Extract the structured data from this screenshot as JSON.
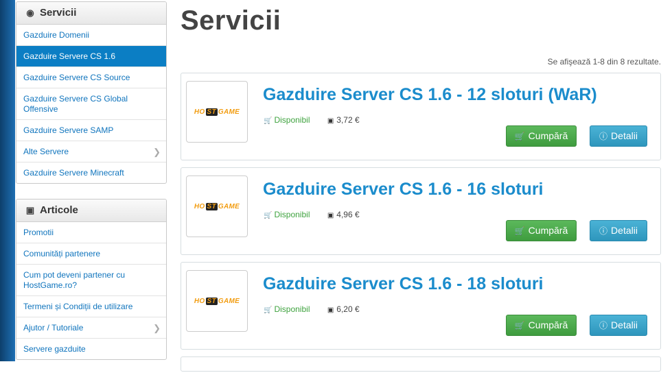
{
  "sidebar": {
    "services": {
      "title": "Servicii",
      "icon": "globe-icon",
      "items": [
        {
          "label": "Gazduire Domenii",
          "active": false
        },
        {
          "label": "Gazduire Servere CS 1.6",
          "active": true
        },
        {
          "label": "Gazduire Servere CS Source",
          "active": false
        },
        {
          "label": "Gazduire Servere CS Global Offensive",
          "active": false
        },
        {
          "label": "Gazduire Servere SAMP",
          "active": false
        },
        {
          "label": "Alte Servere",
          "active": false,
          "has_submenu": true
        },
        {
          "label": "Gazduire Servere Minecraft",
          "active": false
        }
      ]
    },
    "articles": {
      "title": "Articole",
      "icon": "book-icon",
      "items": [
        {
          "label": "Promotii"
        },
        {
          "label": "Comunități partenere"
        },
        {
          "label": "Cum pot deveni partener cu HostGame.ro?"
        },
        {
          "label": "Termeni și Condiții de utilizare"
        },
        {
          "label": "Ajutor / Tutoriale",
          "has_submenu": true
        },
        {
          "label": "Servere gazduite"
        }
      ]
    }
  },
  "main": {
    "title": "Servicii",
    "results_text": "Se afişează 1-8 din 8 rezultate.",
    "products": [
      {
        "title": "Gazduire Server CS 1.6 - 12 sloturi (WaR)",
        "status": "Disponibil",
        "price": "3,72 €",
        "buy_label": "Cumpără",
        "details_label": "Detalii",
        "logo": {
          "left": "HO",
          "mid": "ST",
          "right": "GAME"
        }
      },
      {
        "title": "Gazduire Server CS 1.6 - 16 sloturi",
        "status": "Disponibil",
        "price": "4,96 €",
        "buy_label": "Cumpără",
        "details_label": "Detalii",
        "logo": {
          "left": "HO",
          "mid": "ST",
          "right": "GAME"
        }
      },
      {
        "title": "Gazduire Server CS 1.6 - 18 sloturi",
        "status": "Disponibil",
        "price": "6,20 €",
        "buy_label": "Cumpără",
        "details_label": "Detalii",
        "logo": {
          "left": "HO",
          "mid": "ST",
          "right": "GAME"
        }
      }
    ]
  },
  "colors": {
    "accent": "#0b7ec4",
    "link": "#0f74bd",
    "title": "#1b8ccc",
    "available": "#3ea23e",
    "buy": "#4cae4c",
    "details": "#39a6cc"
  }
}
